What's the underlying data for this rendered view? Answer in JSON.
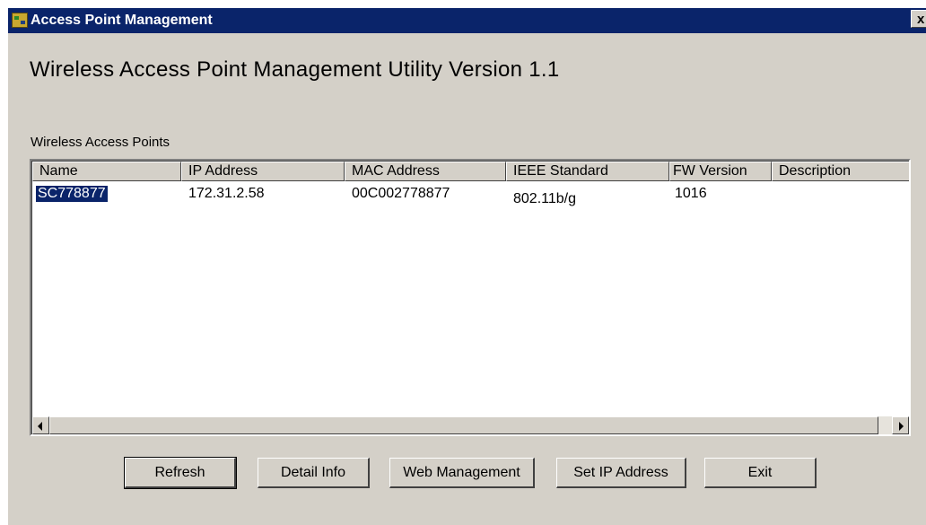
{
  "window": {
    "title": "Access Point Management",
    "close_label": "x"
  },
  "heading": "Wireless Access Point Management Utility Version 1.1",
  "group_label": "Wireless Access Points",
  "table": {
    "columns": [
      "Name",
      "IP Address",
      "MAC Address",
      "IEEE Standard",
      "FW Version",
      "Description"
    ],
    "rows": [
      {
        "name": "SC778877",
        "ip": "172.31.2.58",
        "mac": "00C002778877",
        "standard": "802.11b/g",
        "fw": "1016",
        "description": ""
      }
    ]
  },
  "buttons": {
    "refresh": "Refresh",
    "detail_info": "Detail Info",
    "web_management": "Web Management",
    "set_ip": "Set IP Address",
    "exit": "Exit"
  },
  "colors": {
    "titlebar": "#0a246a",
    "face": "#d4d0c8",
    "selection": "#0a246a"
  }
}
